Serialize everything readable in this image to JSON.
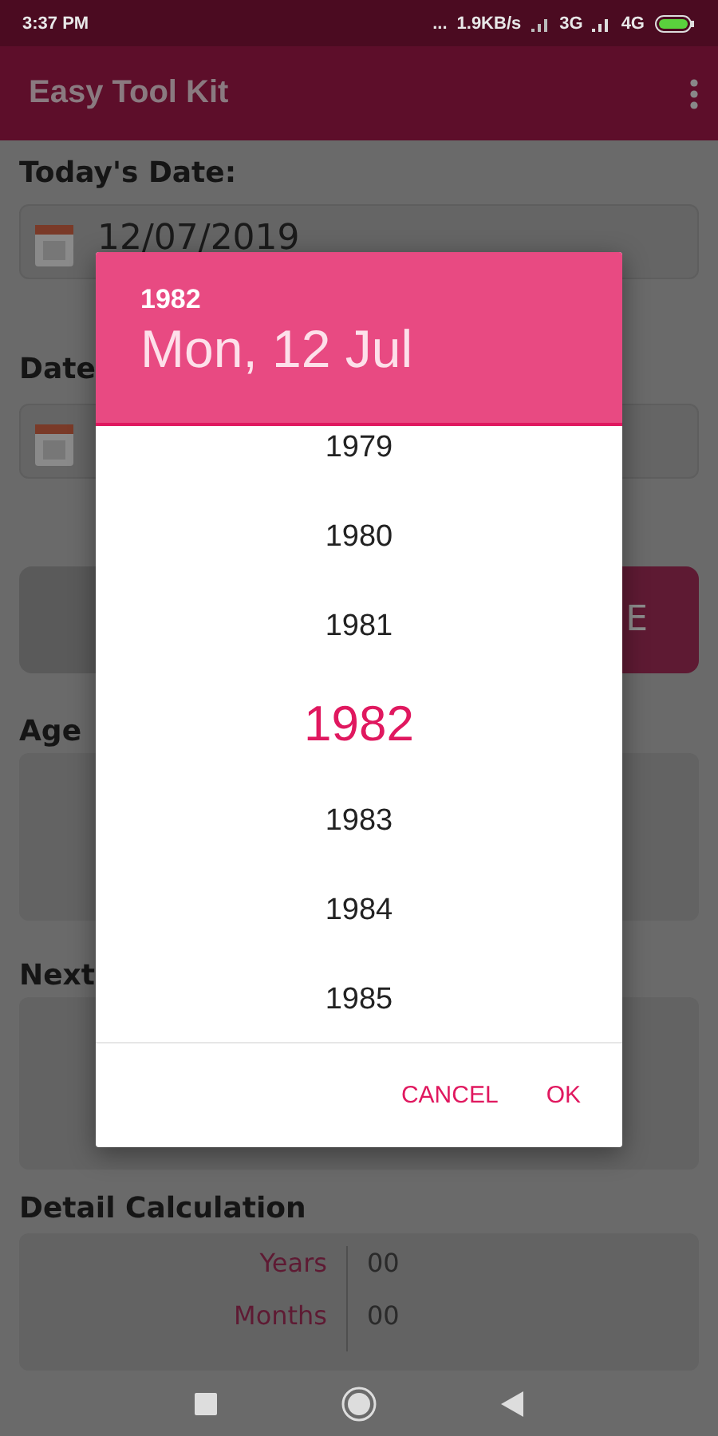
{
  "status_bar": {
    "time": "3:37 PM",
    "more": "...",
    "speed": "1.9KB/s",
    "network_1": "3G",
    "network_2": "4G"
  },
  "app_bar": {
    "title": "Easy Tool Kit"
  },
  "form": {
    "today_label": "Today's Date:",
    "today_value": "12/07/2019",
    "birth_label": "Date",
    "button_text": "E",
    "age_label": "Age",
    "next_label": "Next",
    "detail_title": "Detail Calculation",
    "detail_rows": [
      {
        "label": "Years",
        "value": "00"
      },
      {
        "label": "Months",
        "value": "00"
      }
    ]
  },
  "dialog": {
    "header_year": "1982",
    "header_date": "Mon, 12 Jul",
    "years": [
      {
        "label": "1979",
        "selected": false
      },
      {
        "label": "1980",
        "selected": false
      },
      {
        "label": "1981",
        "selected": false
      },
      {
        "label": "1982",
        "selected": true
      },
      {
        "label": "1983",
        "selected": false
      },
      {
        "label": "1984",
        "selected": false
      },
      {
        "label": "1985",
        "selected": false
      }
    ],
    "actions": [
      "CANCEL",
      "OK"
    ]
  }
}
